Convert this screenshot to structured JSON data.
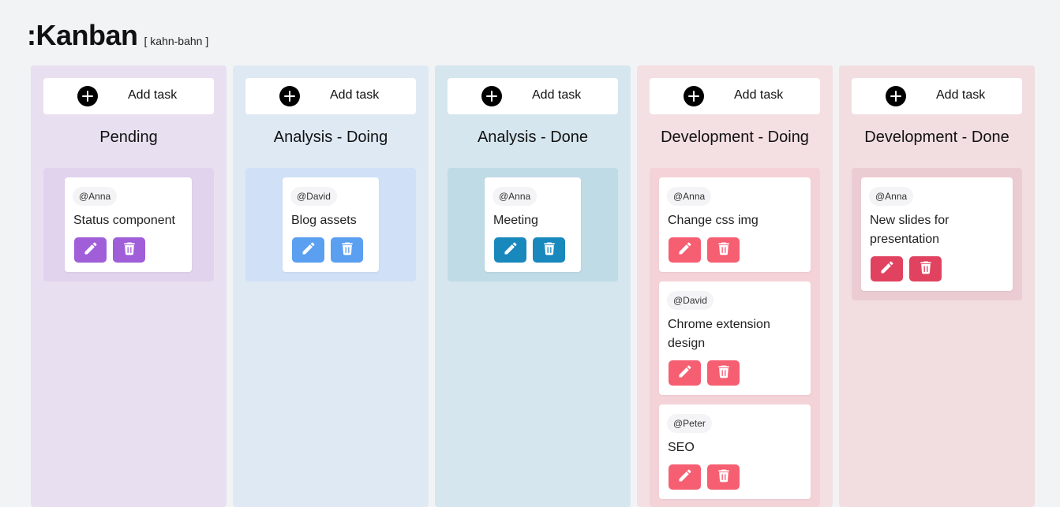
{
  "header": {
    "logo": ":Kanban",
    "subtitle": "[ kahn-bahn ]"
  },
  "add_task_label": "Add task",
  "columns": [
    {
      "title": "Pending",
      "colors": {
        "bg": "#e8e0f0",
        "lane": "#e1d3ee",
        "btn": "#a05ed8"
      },
      "tasks": [
        {
          "assignee": "@Anna",
          "title": "Status component"
        }
      ]
    },
    {
      "title": "Analysis - Doing",
      "colors": {
        "bg": "#dfe9f4",
        "lane": "#cfe0f7",
        "btn": "#5a9ff0"
      },
      "tasks": [
        {
          "assignee": "@David",
          "title": "Blog assets"
        }
      ]
    },
    {
      "title": "Analysis - Done",
      "colors": {
        "bg": "#d5e6ee",
        "lane": "#bfdbe6",
        "btn": "#1888bd"
      },
      "tasks": [
        {
          "assignee": "@Anna",
          "title": "Meeting"
        }
      ]
    },
    {
      "title": "Development - Doing",
      "colors": {
        "bg": "#f4dfe2",
        "lane": "#f4d3d8",
        "btn": "#f65e72"
      },
      "tasks": [
        {
          "assignee": "@Anna",
          "title": "Change css img"
        },
        {
          "assignee": "@David",
          "title": "Chrome extension design"
        },
        {
          "assignee": "@Peter",
          "title": "SEO"
        }
      ]
    },
    {
      "title": "Development - Done",
      "colors": {
        "bg": "#f2dee1",
        "lane": "#ecccd3",
        "btn": "#e0425f"
      },
      "tasks": [
        {
          "assignee": "@Anna",
          "title": "New slides for presentation"
        }
      ]
    }
  ]
}
